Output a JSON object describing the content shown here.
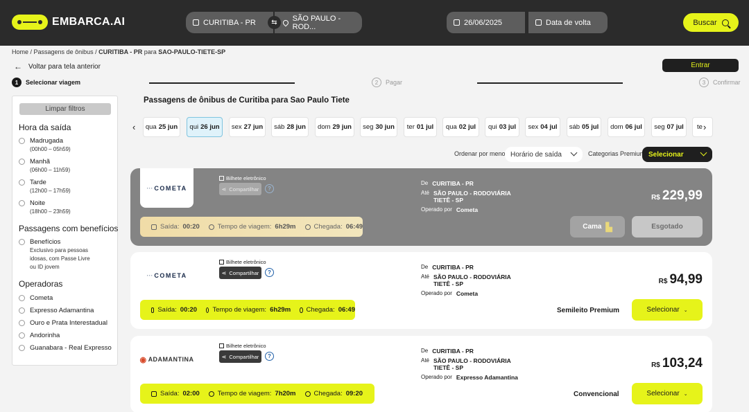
{
  "header": {
    "logo_text": "EMBARCA.AI",
    "origin": "CURITIBA - PR",
    "destination": "SÃO PAULO - ROD...",
    "departure_date": "26/06/2025",
    "return_placeholder": "Data de volta",
    "search_label": "Buscar",
    "brand_color": "#e6f31a"
  },
  "breadcrumb": {
    "home": "Home",
    "sep": " / ",
    "section": "Passagens de ônibus",
    "route_from": "CURITIBA - PR",
    "para": " para ",
    "route_to": "SAO-PAULO-TIETE-SP"
  },
  "back_label": "Voltar para tela anterior",
  "login_label": "Entrar",
  "steps": [
    {
      "num": "1",
      "label": "Selecionar viagem"
    },
    {
      "num": "2",
      "label": "Pagar"
    },
    {
      "num": "3",
      "label": "Confirmar"
    }
  ],
  "sidebar": {
    "clear_label": "Limpar filtros",
    "departure_title": "Hora da saída",
    "departure_options": [
      {
        "label": "Madrugada",
        "range": "(00h00 – 05h59)"
      },
      {
        "label": "Manhã",
        "range": "(06h00 – 11h59)"
      },
      {
        "label": "Tarde",
        "range": "(12h00 – 17h59)"
      },
      {
        "label": "Noite",
        "range": "(18h00 – 23h59)"
      }
    ],
    "benefits_title": "Passagens com benefícios",
    "benefit_label": "Benefícios",
    "benefit_desc_1": "Exclusivo para pessoas",
    "benefit_desc_2": "idosas, com Passe Livre",
    "benefit_desc_3": "ou ID jovem",
    "operators_title": "Operadoras",
    "operators": [
      "Cometa",
      "Expresso Adamantina",
      "Ouro e Prata Interestadual",
      "Andorinha",
      "Guanabara - Real Expresso"
    ]
  },
  "main": {
    "title": "Passagens de ônibus de Curitiba para Sao Paulo Tiete",
    "dates": [
      {
        "day": "qua",
        "date": "25 jun"
      },
      {
        "day": "qui",
        "date": "26 jun"
      },
      {
        "day": "sex",
        "date": "27 jun"
      },
      {
        "day": "sáb",
        "date": "28 jun"
      },
      {
        "day": "dom",
        "date": "29 jun"
      },
      {
        "day": "seg",
        "date": "30 jun"
      },
      {
        "day": "ter",
        "date": "01 jul"
      },
      {
        "day": "qua",
        "date": "02 jul"
      },
      {
        "day": "qui",
        "date": "03 jul"
      },
      {
        "day": "sex",
        "date": "04 jul"
      },
      {
        "day": "sáb",
        "date": "05 jul"
      },
      {
        "day": "dom",
        "date": "06 jul"
      },
      {
        "day": "seg",
        "date": "07 jul"
      },
      {
        "day": "te",
        "date": ""
      }
    ],
    "selected_date_index": 1,
    "sort_label": "Ordenar por menor",
    "sort_value": "Horário de saída",
    "premium_label": "Categorias Premium",
    "premium_value": "Selecionar"
  },
  "labels": {
    "bilhete": "Bilhete eletrônico",
    "compartilhar": "Compartilhar",
    "de": "De",
    "ate": "Até",
    "operado_por": "Operado por",
    "saida": "Saída:",
    "tempo": "Tempo de viagem:",
    "chegada": "Chegada:",
    "currency": "R$",
    "select": "Selecionar",
    "help": "?"
  },
  "trips": [
    {
      "operator_logo": "COMETA",
      "origin": "CURITIBA - PR",
      "dest_1": "SÃO PAULO - RODOVIÁRIA",
      "dest_2": "TIETÊ - SP",
      "operator": "Cometa",
      "price": "229,99",
      "departure": "00:20",
      "duration": "6h29m",
      "arrival": "06:49",
      "seat_type": "Cama",
      "status": "Esgotado"
    },
    {
      "operator_logo": "COMETA",
      "origin": "CURITIBA - PR",
      "dest_1": "SÃO PAULO - RODOVIÁRIA",
      "dest_2": "TIETÊ - SP",
      "operator": "Cometa",
      "price": "94,99",
      "departure": "00:20",
      "duration": "6h29m",
      "arrival": "06:49",
      "seat_type": "Semileito Premium"
    },
    {
      "operator_logo": "ADAMANTINA",
      "origin": "CURITIBA - PR",
      "dest_1": "SÃO PAULO - RODOVIÁRIA",
      "dest_2": "TIETÊ - SP",
      "operator": "Expresso Adamantina",
      "price": "103,24",
      "departure": "02:00",
      "duration": "7h20m",
      "arrival": "09:20",
      "seat_type": "Convencional"
    }
  ]
}
